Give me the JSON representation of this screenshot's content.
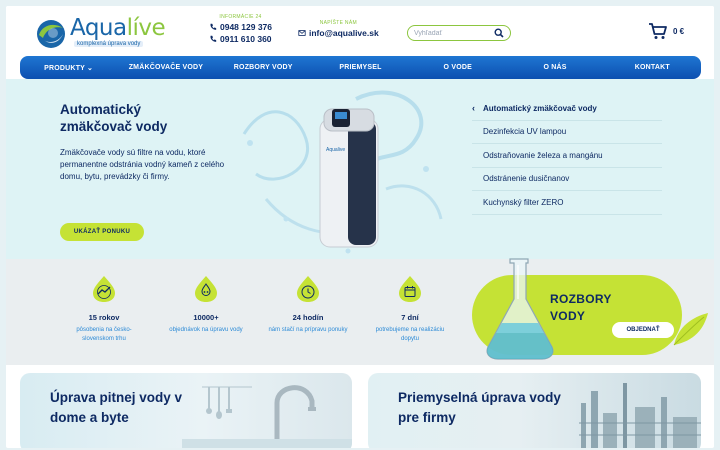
{
  "brand": {
    "name_a": "Aqua",
    "name_b": "líve",
    "tagline": "komplexná úprava vody"
  },
  "contact": {
    "phone_label": "INFORMÁCIE 24",
    "phone1": "0948 129 376",
    "phone2": "0911 610 360",
    "email_label": "NAPÍŠTE NÁM",
    "email": "info@aqualive.sk"
  },
  "search": {
    "placeholder": "Vyhľadať"
  },
  "cart": {
    "total": "0 €"
  },
  "nav": [
    "PRODUKTY ⌄",
    "ZMÄKČOVAČE VODY",
    "ROZBORY VODY",
    "PRIEMYSEL",
    "O VODE",
    "O NÁS",
    "KONTAKT"
  ],
  "hero": {
    "title": "Automatický zmäkčovač vody",
    "text": "Zmäkčovače vody sú filtre na vodu, ktoré permanentne odstránia vodný kameň z celého domu, bytu, prevádzky či firmy.",
    "button": "UKÁZAŤ PONUKU",
    "brand_on_device": "Aqualive"
  },
  "side_menu": [
    {
      "label": "Automatický zmäkčovač vody",
      "active": true
    },
    {
      "label": "Dezinfekcia UV lampou",
      "active": false
    },
    {
      "label": "Odstraňovanie železa a mangánu",
      "active": false
    },
    {
      "label": "Odstránenie dusičnanov",
      "active": false
    },
    {
      "label": "Kuchynský filter ZERO",
      "active": false
    }
  ],
  "stats": [
    {
      "icon": "chart-trend-icon",
      "value": "15 rokov",
      "text": "pôsobenia na česko-slovenskom trhu"
    },
    {
      "icon": "water-drops-icon",
      "value": "10000+",
      "text": "objednávok na úpravu vody"
    },
    {
      "icon": "clock-icon",
      "value": "24 hodín",
      "text": "nám stačí na prípravu ponuky"
    },
    {
      "icon": "calendar-icon",
      "value": "7 dní",
      "text": "potrebujeme na realizáciu dopytu"
    }
  ],
  "promo": {
    "title_line1": "ROZBORY",
    "title_line2": "VODY",
    "button": "OBJEDNAŤ"
  },
  "cards": [
    {
      "title": "Úprava pitnej vody v dome a byte"
    },
    {
      "title": "Priemyselná úprava vody pre firmy"
    }
  ],
  "colors": {
    "navy": "#0e2a63",
    "nav_blue": "#1a63c4",
    "lime": "#c5e235",
    "hero_bg": "#def3f5",
    "stats_bg": "#eaeef0"
  }
}
